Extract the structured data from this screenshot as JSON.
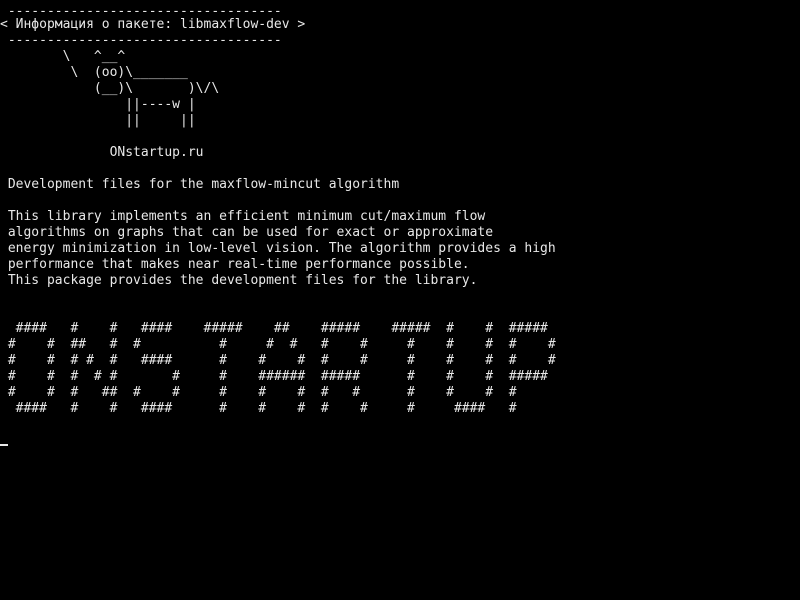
{
  "colors": {
    "background": "#000000",
    "foreground": "#e8e8e8"
  },
  "terminal": {
    "lines": [
      " -----------------------------------",
      "< Информация о пакете: libmaxflow-dev >",
      " -----------------------------------",
      "        \\   ^__^",
      "         \\  (oo)\\_______",
      "            (__)\\       )\\/\\",
      "                ||----w |",
      "                ||     ||",
      "",
      "              ONstartup.ru",
      "",
      " Development files for the maxflow-mincut algorithm",
      "",
      " This library implements an efficient minimum cut/maximum flow",
      " algorithms on graphs that can be used for exact or approximate",
      " energy minimization in low-level vision. The algorithm provides a high",
      " performance that makes near real-time performance possible.",
      " This package provides the development files for the library.",
      "",
      "",
      "  ####   #    #   ####    #####    ##    #####    #####  #    #  #####",
      " #    #  ##   #  #          #     #  #   #    #     #    #    #  #    #",
      " #    #  # #  #   ####      #    #    #  #    #     #    #    #  #    #",
      " #    #  #  # #       #     #    ######  #####      #    #    #  #####",
      " #    #  #   ##  #    #     #    #    #  #   #      #    #    #  #",
      "  ####   #    #   ####      #    #    #  #    #     #     ####   #"
    ]
  }
}
